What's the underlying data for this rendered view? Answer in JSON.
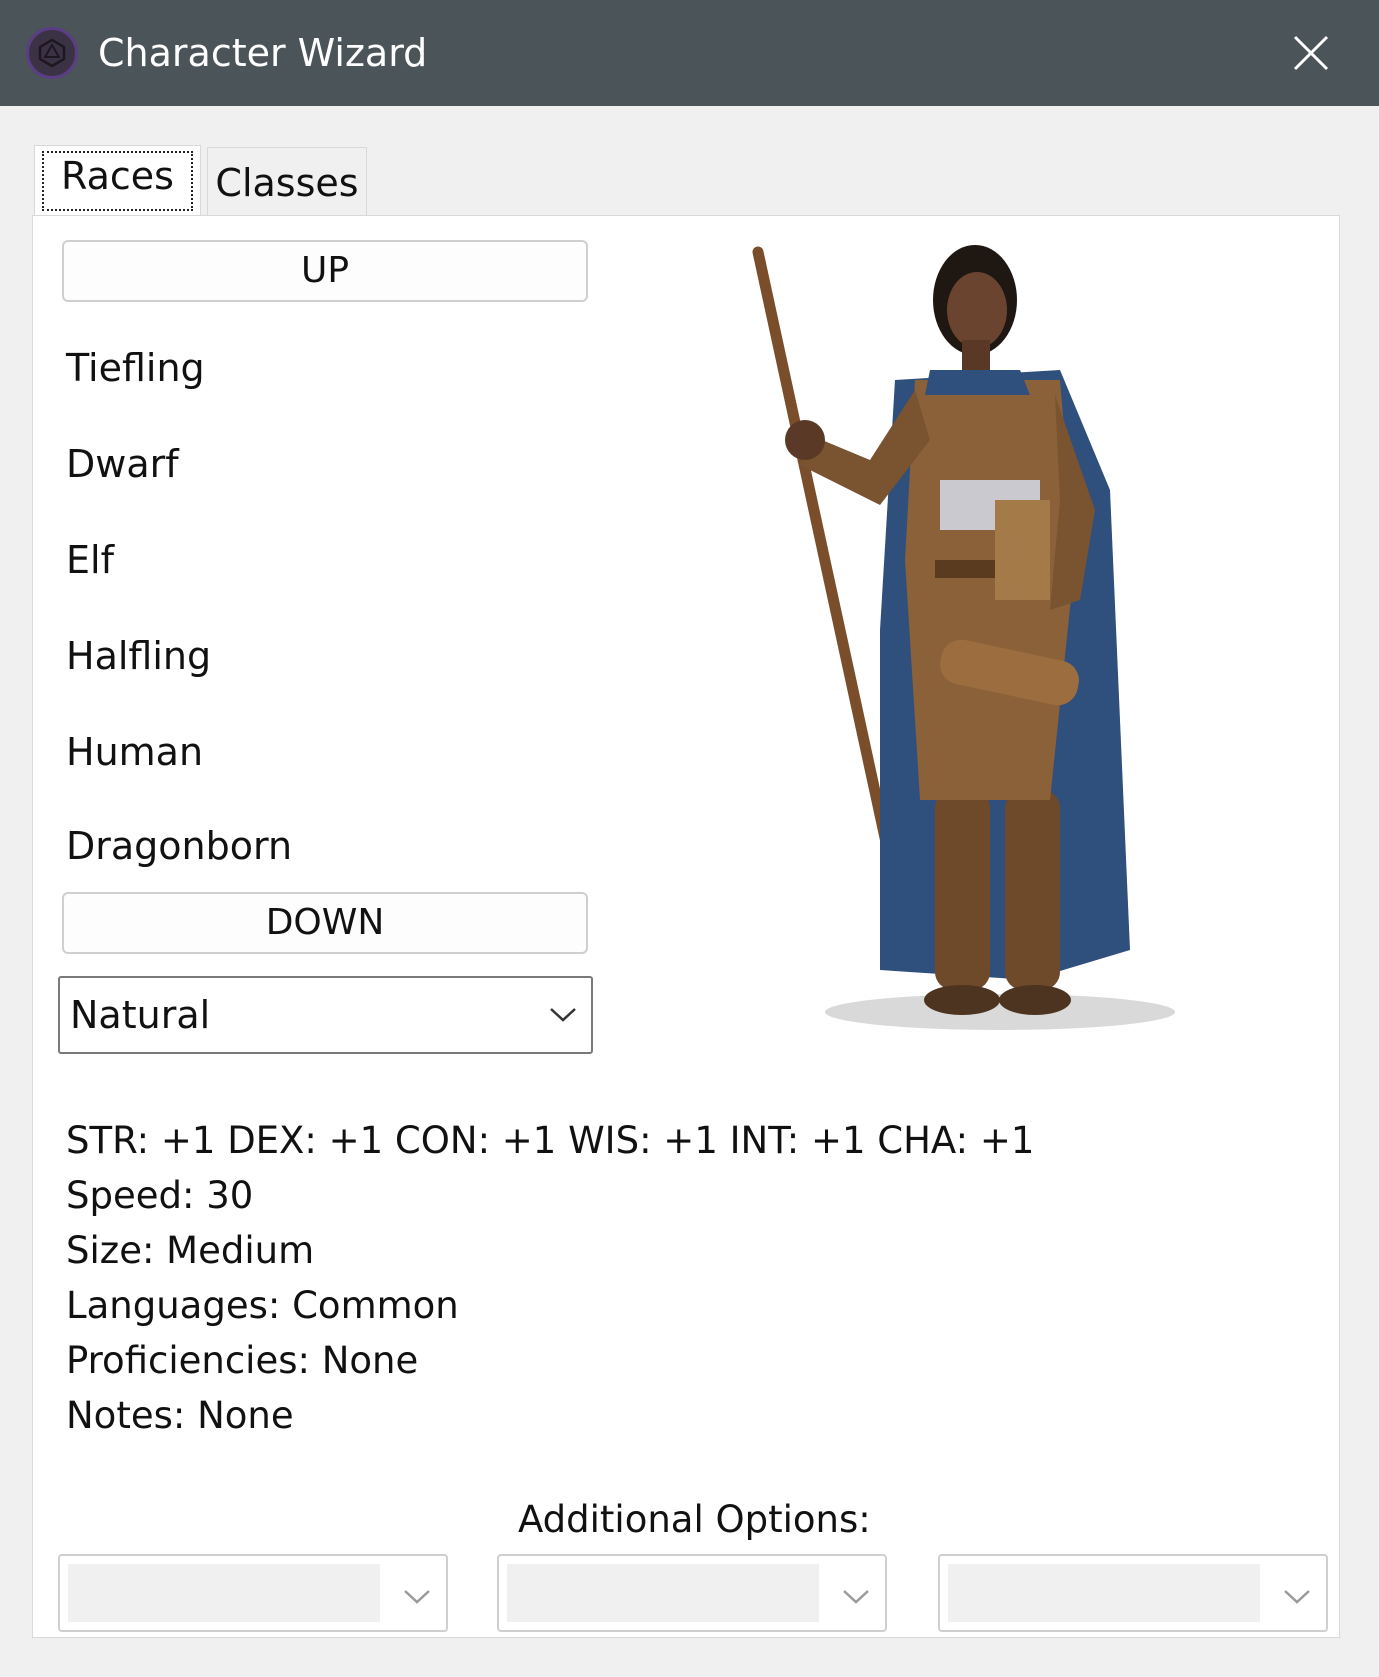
{
  "window": {
    "title": "Character Wizard",
    "app_icon": "d20-icon",
    "close_icon": "close-icon"
  },
  "tabs": [
    {
      "label": "Races",
      "selected": true
    },
    {
      "label": "Classes",
      "selected": false
    }
  ],
  "races_panel": {
    "up_label": "UP",
    "down_label": "DOWN",
    "race_list": [
      "Tiefling",
      "Dwarf",
      "Elf",
      "Halfling",
      "Human",
      "Dragonborn"
    ],
    "subrace_select": {
      "value": "Natural"
    }
  },
  "stats": {
    "abilities": "STR: +1 DEX: +1 CON: +1 WIS: +1 INT: +1 CHA: +1",
    "speed": "Speed: 30",
    "size": "Size: Medium",
    "languages": "Languages: Common",
    "proficiencies": "Proficiencies: None",
    "notes": "Notes: None"
  },
  "additional_options": {
    "label": "Additional Options:",
    "selects": [
      {
        "value": ""
      },
      {
        "value": ""
      },
      {
        "value": ""
      }
    ]
  },
  "colors": {
    "titlebar": "#4a5459",
    "window_bg": "#f0f0f0",
    "panel_bg": "#ffffff",
    "cloak_blue": "#2f4f7c",
    "armor_bronze": "#8a6138"
  }
}
